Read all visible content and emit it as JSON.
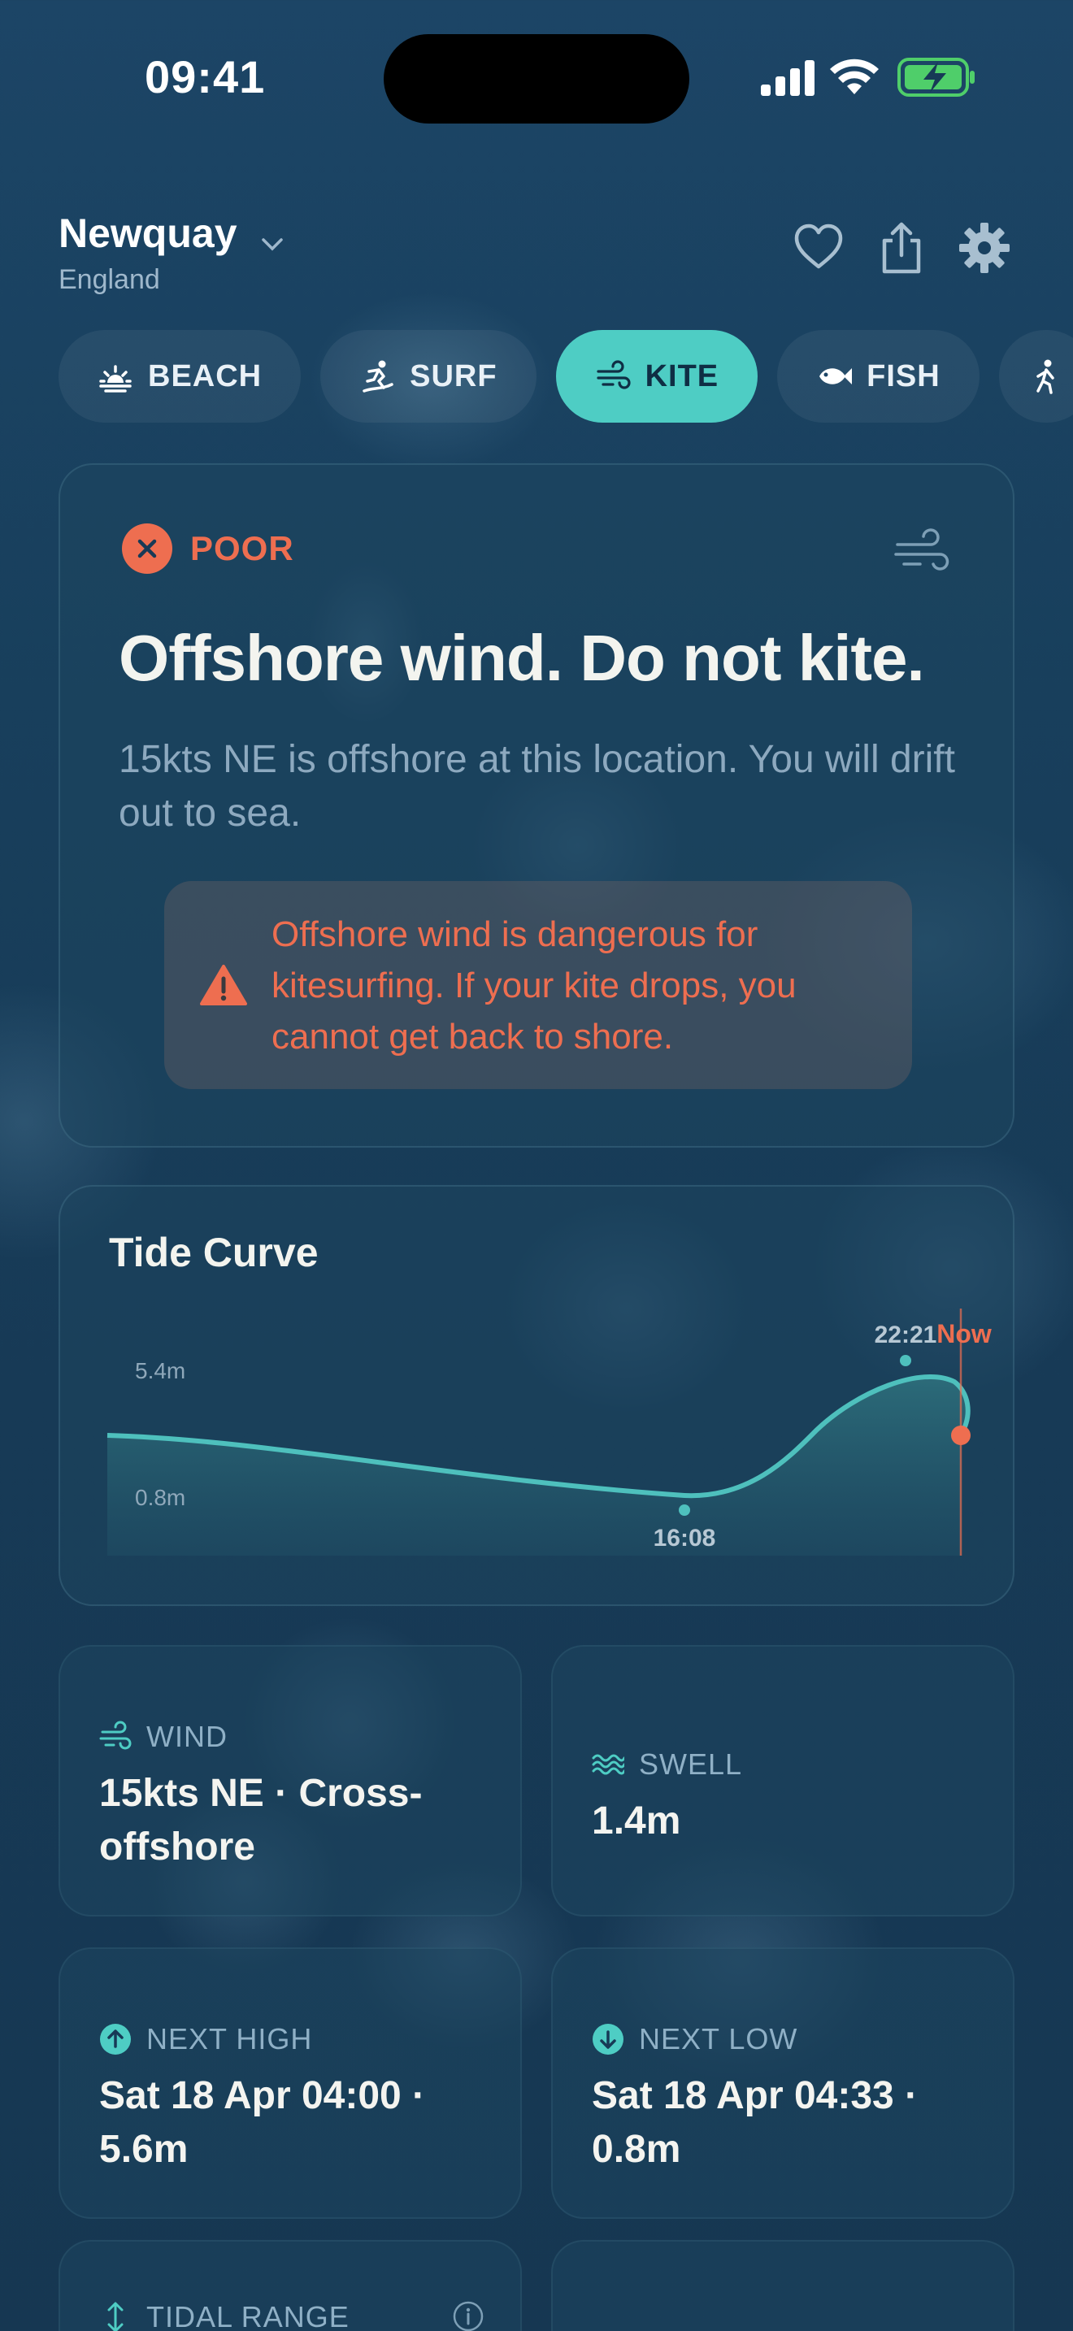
{
  "status": {
    "time": "09:41"
  },
  "location": {
    "name": "Newquay",
    "region": "England"
  },
  "activities": [
    {
      "label": "BEACH",
      "icon": "sunrise-icon",
      "active": false
    },
    {
      "label": "SURF",
      "icon": "surfer-icon",
      "active": false
    },
    {
      "label": "KITE",
      "icon": "wind-icon",
      "active": true
    },
    {
      "label": "FISH",
      "icon": "fish-icon",
      "active": false
    },
    {
      "label": "",
      "icon": "walker-icon",
      "active": false
    }
  ],
  "rating": {
    "badge": "POOR",
    "headline": "Offshore wind. Do not kite.",
    "description": "15kts NE is offshore at this location. You will drift out to sea.",
    "warning": "Offshore wind is dangerous for kitesurfing. If your kite drops, you cannot get back to shore."
  },
  "tide": {
    "title": "Tide Curve",
    "high_label": "5.4m",
    "low_label": "0.8m",
    "low_time": "16:08",
    "high_time": "22:21",
    "now_label": "Now"
  },
  "chart_data": {
    "type": "area",
    "title": "Tide Curve",
    "x": [
      "now-start",
      "16:08",
      "22:21",
      "Now"
    ],
    "series": [
      {
        "values": [
          2.6,
          0.8,
          5.4,
          2.6
        ]
      }
    ],
    "annotations": [
      "5.4m",
      "0.8m",
      "16:08",
      "22:21",
      "Now"
    ],
    "y_range": [
      0.8,
      5.4
    ]
  },
  "tiles": {
    "wind": {
      "label": "WIND",
      "value": "15kts NE · Cross-offshore"
    },
    "swell": {
      "label": "SWELL",
      "value": "1.4m"
    },
    "next_high": {
      "label": "NEXT HIGH",
      "value": "Sat 18 Apr 04:00 · 5.6m"
    },
    "next_low": {
      "label": "NEXT LOW",
      "value": "Sat 18 Apr 04:33 · 0.8m"
    },
    "tidal_range": {
      "label": "TIDAL RANGE"
    }
  },
  "colors": {
    "accent": "#4ecdc4",
    "danger": "#ee6e50",
    "background": "#1a4160"
  }
}
